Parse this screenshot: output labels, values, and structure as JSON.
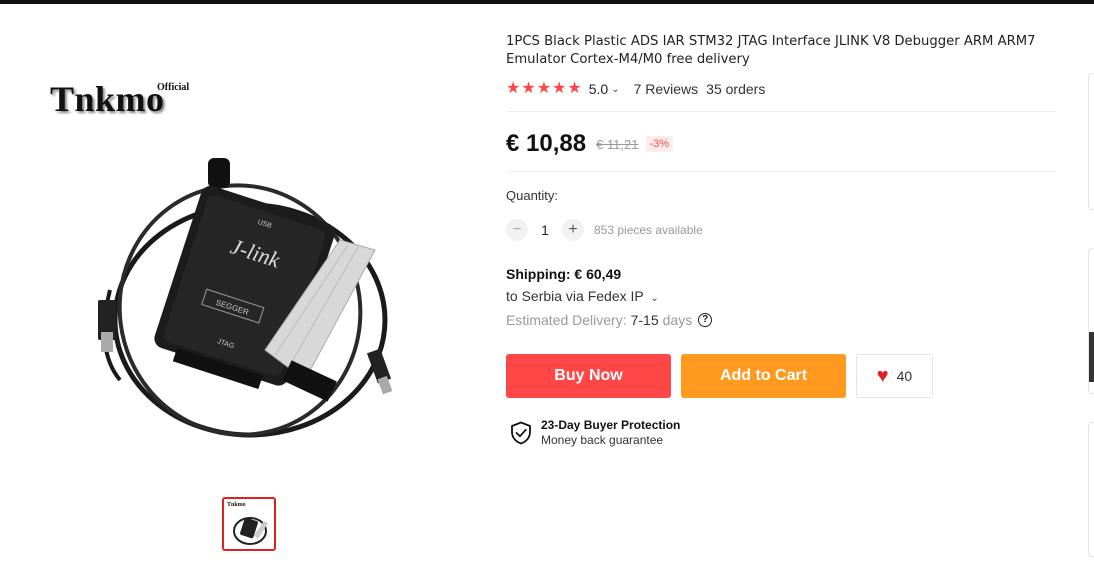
{
  "product": {
    "title": "1PCS Black Plastic ADS IAR STM32 JTAG Interface JLINK V8 Debugger ARM ARM7 Emulator Cortex-M4/M0 free delivery",
    "brand": "Tnkmo",
    "brand_tag": "Official",
    "device_label": "J-link",
    "device_port_top": "USB",
    "device_port_bottom": "JTAG",
    "device_logo": "SEGGER"
  },
  "rating": {
    "stars": 5,
    "value": "5.0",
    "reviews": "7 Reviews",
    "orders": "35 orders"
  },
  "price": {
    "current": "€ 10,88",
    "original": "€ 11,21",
    "discount": "-3%"
  },
  "quantity": {
    "label": "Quantity:",
    "value": "1",
    "minus": "−",
    "plus": "+",
    "available": "853 pieces available"
  },
  "shipping": {
    "title": "Shipping: € 60,49",
    "destination": "to Serbia via Fedex IP",
    "estimated_label": "Estimated Delivery:",
    "estimated_value": "7-15",
    "estimated_unit": "days",
    "help_icon": "?"
  },
  "actions": {
    "buy_now": "Buy Now",
    "add_to_cart": "Add to Cart",
    "wishlist_count": "40"
  },
  "protection": {
    "title": "23-Day Buyer Protection",
    "subtitle": "Money back guarantee"
  },
  "colors": {
    "accent_red": "#ff4747",
    "accent_orange": "#ff9a1f",
    "thumb_border": "#e02020"
  },
  "icons": {
    "star": "star-icon",
    "chevron": "chevron-down-icon",
    "help": "question-circle-icon",
    "heart": "heart-icon",
    "shield": "shield-check-icon"
  }
}
